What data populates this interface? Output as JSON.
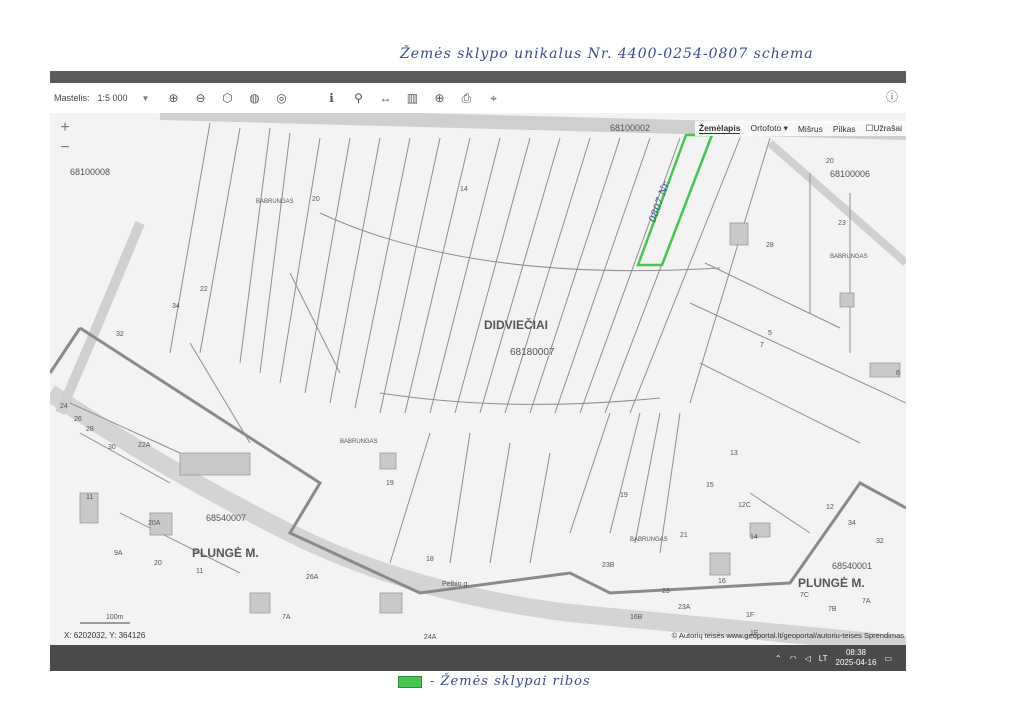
{
  "handwritten_title": "Žemės sklypo unikalus Nr. 4400-0254-0807 schema",
  "legend": {
    "text": "- Žemės sklypai ribos",
    "color": "#47c553"
  },
  "toolbar": {
    "scale_label": "Mastelis:",
    "scale_value": "1:5 000",
    "tools": [
      "zoom-in-icon",
      "zoom-out-icon",
      "select-icon",
      "globe-icon",
      "locate-icon",
      "info-icon",
      "link-icon",
      "measure-icon",
      "profile-icon",
      "add-icon",
      "print-icon",
      "crosshair-icon"
    ],
    "info_icon": "info-icon"
  },
  "basemap": {
    "zemelapis": "Žemėlapis",
    "ortofoto": "Ortofoto",
    "misrus": "Mišrus",
    "pilkas": "Pilkas",
    "uzrasai": "Užrašai"
  },
  "map": {
    "area_name": "DIDVIEČIAI",
    "area_code": "68180007",
    "codes": {
      "nw": "68100008",
      "ne": "68100006",
      "n": "68100002",
      "sw": "68540007",
      "se": "68540001"
    },
    "town_sw": "PLUNGĖ M.",
    "town_se": "PLUNGĖ M.",
    "street_babrungas": "BABRUNGAS",
    "bridge_label": "Pelbio g.",
    "parcel_labels": [
      "14",
      "20",
      "22",
      "34",
      "32",
      "24",
      "26",
      "28",
      "30",
      "22A",
      "11",
      "20A",
      "9A",
      "20",
      "11",
      "26A",
      "7A",
      "24A",
      "19",
      "18",
      "20",
      "23",
      "28",
      "5",
      "7",
      "6",
      "13",
      "15",
      "19",
      "21",
      "12C",
      "14",
      "12",
      "34",
      "32",
      "16",
      "23B",
      "23",
      "23A",
      "16B",
      "1F",
      "7C",
      "7B",
      "7A",
      "1E"
    ],
    "handwritten_parcel": "0807 Nr.",
    "scale_bar": "100m",
    "highlight_color": "#47c553"
  },
  "status": {
    "coords": "X: 6202032, Y: 364126",
    "attribution": "© Autorių teisės www.geoportal.lt/geoportal/autoriu-teises  Sprendimas",
    "clock_time": "08:38",
    "clock_date": "2025-04-16",
    "lang": "LT"
  }
}
